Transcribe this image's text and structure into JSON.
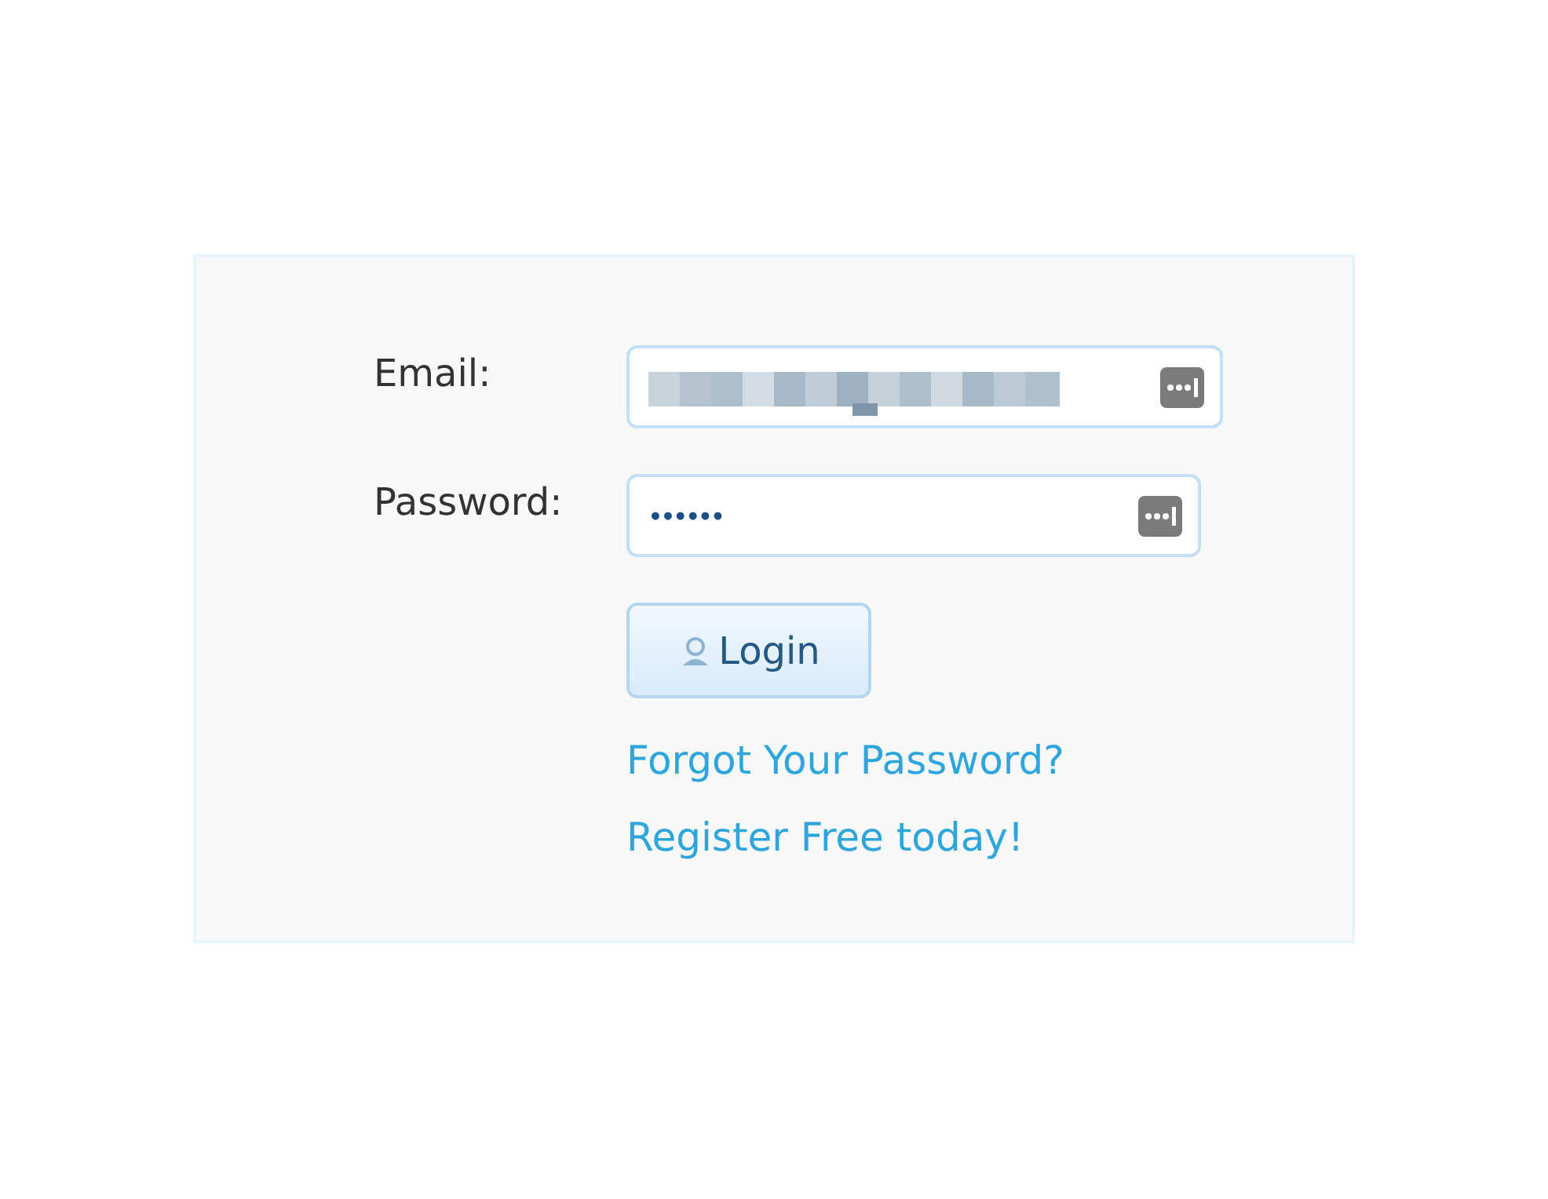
{
  "login_form": {
    "fields": [
      {
        "label": "Email:",
        "kind": "redacted"
      },
      {
        "label": "Password:",
        "kind": "password",
        "value": "••••••"
      }
    ],
    "button": {
      "label": "Login"
    },
    "links": [
      "Forgot Your Password?",
      "Register Free today!"
    ]
  }
}
